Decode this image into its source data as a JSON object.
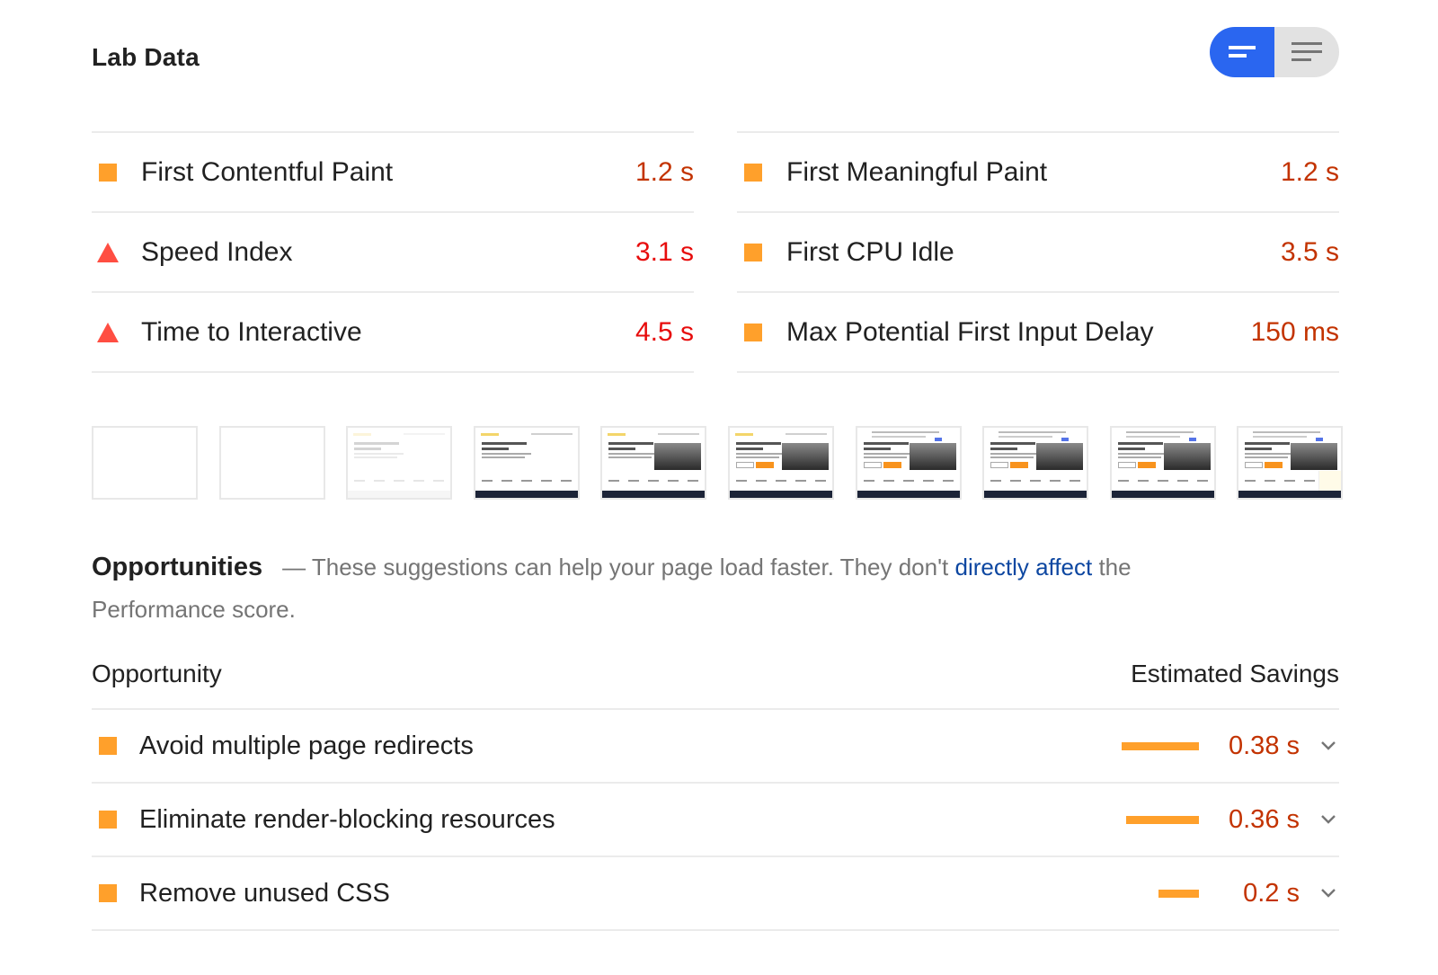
{
  "lab_data": {
    "title": "Lab Data",
    "view_toggle": {
      "options": [
        {
          "name": "summary-view",
          "icon": "summary-bars-icon",
          "active": true
        },
        {
          "name": "list-view",
          "icon": "list-lines-icon",
          "active": false
        }
      ],
      "active_color": "#2a66f0",
      "inactive_color": "#e2e2e2"
    },
    "metrics_left": [
      {
        "label": "First Contentful Paint",
        "value": "1.2 s",
        "rating": "average",
        "icon": "orange-square-icon"
      },
      {
        "label": "Speed Index",
        "value": "3.1 s",
        "rating": "fail",
        "icon": "red-triangle-icon"
      },
      {
        "label": "Time to Interactive",
        "value": "4.5 s",
        "rating": "fail",
        "icon": "red-triangle-icon"
      }
    ],
    "metrics_right": [
      {
        "label": "First Meaningful Paint",
        "value": "1.2 s",
        "rating": "average",
        "icon": "orange-square-icon"
      },
      {
        "label": "First CPU Idle",
        "value": "3.5 s",
        "rating": "average",
        "icon": "orange-square-icon"
      },
      {
        "label": "Max Potential First Input Delay",
        "value": "150 ms",
        "rating": "average",
        "icon": "orange-square-icon"
      }
    ],
    "colors": {
      "average_icon": "#ffa02b",
      "average_text": "#c33300",
      "fail_icon": "#ff4e42",
      "fail_text": "#e70c0c"
    }
  },
  "filmstrip": {
    "frames": [
      {
        "state": "blank"
      },
      {
        "state": "blank"
      },
      {
        "state": "faded"
      },
      {
        "state": "text"
      },
      {
        "state": "video"
      },
      {
        "state": "buttons"
      },
      {
        "state": "cookie-banner"
      },
      {
        "state": "cookie-banner"
      },
      {
        "state": "cookie-banner"
      },
      {
        "state": "chat-widget"
      }
    ]
  },
  "opportunities": {
    "title": "Opportunities",
    "dash": "—",
    "description_before": "These suggestions can help your page load faster. They don't",
    "link_text": "directly affect",
    "description_after": "the Performance score.",
    "column_opportunity": "Opportunity",
    "column_savings": "Estimated Savings",
    "items": [
      {
        "label": "Avoid multiple page redirects",
        "savings": "0.38 s",
        "savings_seconds": 0.38,
        "icon": "orange-square-icon"
      },
      {
        "label": "Eliminate render-blocking resources",
        "savings": "0.36 s",
        "savings_seconds": 0.36,
        "icon": "orange-square-icon"
      },
      {
        "label": "Remove unused CSS",
        "savings": "0.2 s",
        "savings_seconds": 0.2,
        "icon": "orange-square-icon"
      }
    ]
  }
}
